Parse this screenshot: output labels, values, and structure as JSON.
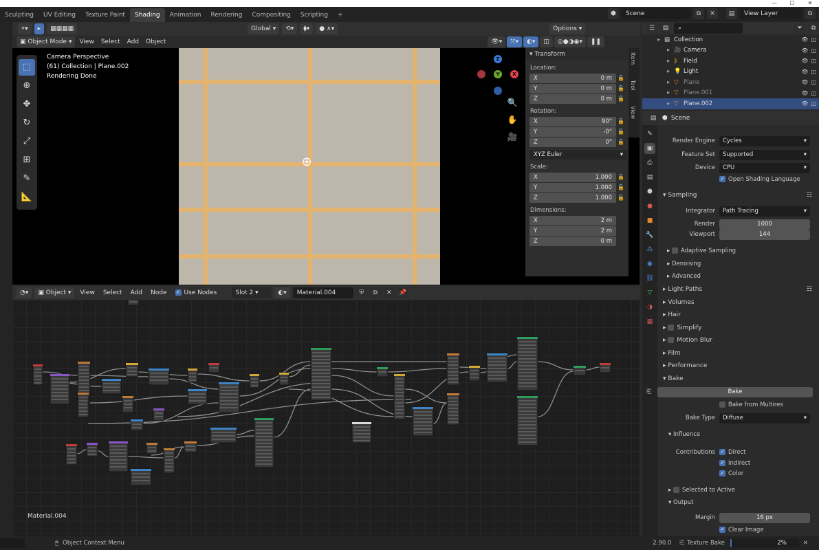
{
  "workspace_tabs": [
    "Sculpting",
    "UV Editing",
    "Texture Paint",
    "Shading",
    "Animation",
    "Rendering",
    "Compositing",
    "Scripting"
  ],
  "active_tab": "Shading",
  "add_tab": "+",
  "scene": {
    "label": "Scene",
    "view_layer": "View Layer"
  },
  "viewport": {
    "mode": "Object Mode",
    "menus": [
      "View",
      "Select",
      "Add",
      "Object"
    ],
    "orientation": "Global",
    "options": "Options",
    "overlay_lines": [
      "Camera Perspective",
      "(61) Collection | Plane.002",
      "Rendering Done"
    ],
    "gizmo": {
      "z": "Z",
      "y": "Y",
      "x": "X"
    }
  },
  "npanel": {
    "title": "Transform",
    "location_label": "Location:",
    "location": [
      {
        "axis": "X",
        "value": "0 m"
      },
      {
        "axis": "Y",
        "value": "0 m"
      },
      {
        "axis": "Z",
        "value": "0 m"
      }
    ],
    "rotation_label": "Rotation:",
    "rotation": [
      {
        "axis": "X",
        "value": "90°"
      },
      {
        "axis": "Y",
        "value": "-0°"
      },
      {
        "axis": "Z",
        "value": "0°"
      }
    ],
    "rotation_mode": "XYZ Euler",
    "scale_label": "Scale:",
    "scale": [
      {
        "axis": "X",
        "value": "1.000"
      },
      {
        "axis": "Y",
        "value": "1.000"
      },
      {
        "axis": "Z",
        "value": "1.000"
      }
    ],
    "dimensions_label": "Dimensions:",
    "dimensions": [
      {
        "axis": "X",
        "value": "2 m"
      },
      {
        "axis": "Y",
        "value": "2 m"
      },
      {
        "axis": "Z",
        "value": "0 m"
      }
    ],
    "tabs": [
      "Item",
      "Tool",
      "View"
    ]
  },
  "node_editor": {
    "type": "Object",
    "menus": [
      "View",
      "Select",
      "Add",
      "Node"
    ],
    "use_nodes": "Use Nodes",
    "slot": "Slot 2",
    "material": "Material.004",
    "footer_label": "Material.004"
  },
  "outliner": {
    "search_placeholder": "",
    "items": [
      {
        "name": "Collection",
        "indent": 1,
        "icon": "collection-icon",
        "dim": false,
        "sel": false
      },
      {
        "name": "Camera",
        "indent": 2,
        "icon": "camera-icon",
        "dim": false,
        "sel": false
      },
      {
        "name": "Field",
        "indent": 2,
        "icon": "field-icon",
        "dim": false,
        "sel": false
      },
      {
        "name": "Light",
        "indent": 2,
        "icon": "light-icon",
        "dim": false,
        "sel": false
      },
      {
        "name": "Plane",
        "indent": 2,
        "icon": "mesh-icon",
        "dim": true,
        "sel": false
      },
      {
        "name": "Plane.001",
        "indent": 2,
        "icon": "mesh-icon",
        "dim": true,
        "sel": false
      },
      {
        "name": "Plane.002",
        "indent": 2,
        "icon": "mesh-icon",
        "dim": false,
        "sel": true
      }
    ]
  },
  "properties": {
    "context": "Scene",
    "render_engine_label": "Render Engine",
    "render_engine": "Cycles",
    "feature_set_label": "Feature Set",
    "feature_set": "Supported",
    "device_label": "Device",
    "device": "CPU",
    "osl": "Open Shading Language",
    "sampling": "Sampling",
    "integrator_label": "Integrator",
    "integrator": "Path Tracing",
    "render_label": "Render",
    "render_samples": "1000",
    "viewport_label": "Viewport",
    "viewport_samples": "144",
    "adaptive": "Adaptive Sampling",
    "denoising": "Denoising",
    "advanced": "Advanced",
    "light_paths": "Light Paths",
    "volumes": "Volumes",
    "hair": "Hair",
    "simplify": "Simplify",
    "motion_blur": "Motion Blur",
    "film": "Film",
    "performance": "Performance",
    "bake": "Bake",
    "bake_button": "Bake",
    "bake_multires": "Bake from Multires",
    "bake_type_label": "Bake Type",
    "bake_type": "Diffuse",
    "influence": "Influence",
    "contributions_label": "Contributions",
    "direct": "Direct",
    "indirect": "Indirect",
    "color": "Color",
    "selected_to_active": "Selected to Active",
    "output": "Output",
    "margin_label": "Margin",
    "margin": "16 px",
    "clear_image": "Clear Image"
  },
  "status": {
    "context_menu": "Object Context Menu",
    "version": "2.90.0",
    "job": "Texture Bake",
    "progress_text": "2%",
    "progress": 0.02
  },
  "colors": {
    "accent": "#4772b3",
    "render_grout": "#e4b36d",
    "render_tile": "#bdb6aa"
  }
}
